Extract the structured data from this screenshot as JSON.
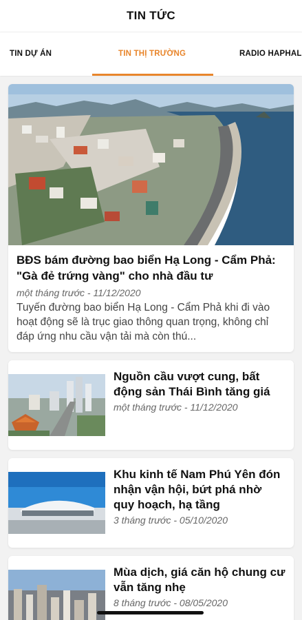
{
  "header": {
    "title": "TIN TỨC"
  },
  "tabs": [
    {
      "label": "TIN DỰ ÁN"
    },
    {
      "label": "TIN THỊ TRƯỜNG"
    },
    {
      "label": "RADIO HAPHAL"
    }
  ],
  "featured": {
    "title": "BĐS bám đường bao biển Hạ Long - Cẩm Phả: \"Gà đẻ trứng vàng\" cho nhà đầu tư",
    "meta": "một tháng trước - 11/12/2020",
    "excerpt": "Tuyến đường bao biển Hạ Long - Cẩm Phả khi đi vào hoạt động sẽ là trục giao thông quan trọng, không chỉ đáp ứng nhu cầu vận tải mà còn thú..."
  },
  "articles": [
    {
      "title": "Nguồn cầu vượt cung, bất động sản Thái Bình tăng giá",
      "meta": "một tháng trước - 11/12/2020"
    },
    {
      "title": "Khu kinh tế Nam Phú Yên đón nhận vận hội, bứt phá nhờ quy hoạch, hạ tầng",
      "meta": "3 tháng trước - 05/10/2020"
    },
    {
      "title": "Mùa dịch, giá căn hộ chung cư vẫn tăng nhẹ",
      "meta": "8 tháng trước - 08/05/2020"
    }
  ],
  "colors": {
    "accent": "#e8852b",
    "background": "#f2f2f2"
  }
}
